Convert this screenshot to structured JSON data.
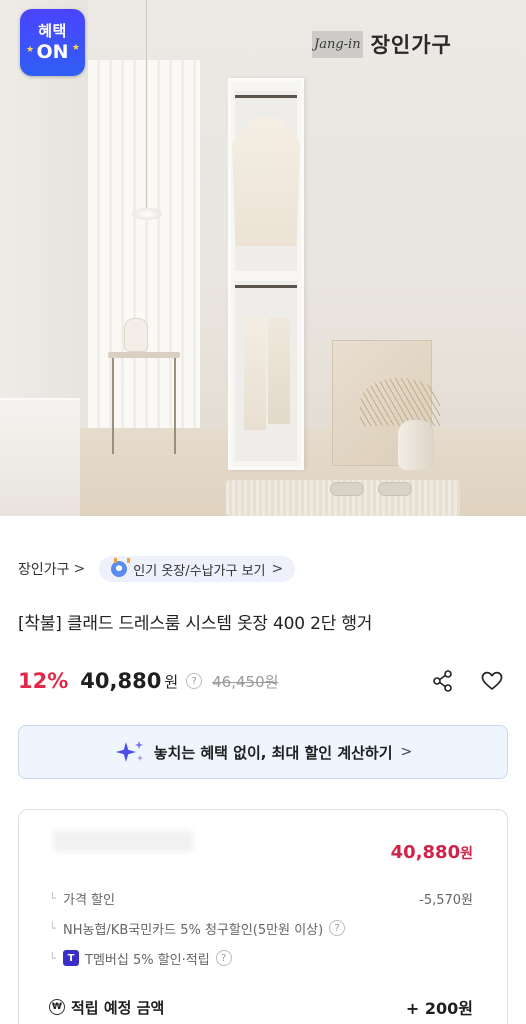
{
  "badge": {
    "line1": "혜택",
    "line2": "ON"
  },
  "brand_logo": {
    "script": "Jang-in",
    "korean": "장인가구"
  },
  "breadcrumb": {
    "brand": "장인가구",
    "brand_chevron": ">",
    "pill_label": "인기 옷장/수납가구 보기",
    "pill_chevron": ">"
  },
  "product": {
    "title": "[착불] 클래드 드레스룸 시스템 옷장 400 2단 행거"
  },
  "price": {
    "discount": "12%",
    "sale": "40,880",
    "currency": "원",
    "help": "?",
    "original": "46,450원"
  },
  "benefit_banner": {
    "label": "놓치는 혜택 없이, 최대 할인 계산하기",
    "chevron": ">"
  },
  "calculator": {
    "total": "40,880",
    "total_unit": "원",
    "lines": [
      {
        "label": "가격 할인",
        "value": "-5,570원"
      },
      {
        "label": "NH농협/KB국민카드 5% 청구할인(5만원 이상)",
        "help": "?"
      },
      {
        "label": "T멤버십 5% 할인·적립",
        "badge": "T",
        "help": "?"
      }
    ],
    "accrual": {
      "coin": "₩",
      "label": "적립 예정 금액",
      "value": "+ 200원"
    }
  },
  "colors": {
    "discount": "#e2284a",
    "badge": "#3a4df5",
    "banner_bg": "#eef5fc"
  }
}
